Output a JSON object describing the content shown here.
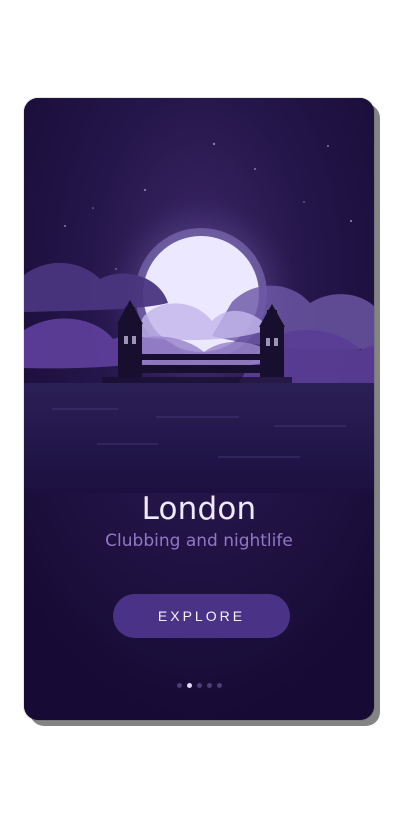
{
  "screen": {
    "title": "London",
    "subtitle": "Clubbing and nightlife",
    "button_label": "EXPLORE",
    "pagination": {
      "count": 5,
      "active_index": 1
    }
  },
  "colors": {
    "card_background": "#1b0f3c",
    "title_text": "#eeeaf9",
    "subtitle_text": "#8f78c5",
    "button_background": "#4a3386",
    "button_text": "#f4f0ff",
    "active_dot": "#e2d9ff",
    "inactive_dot": "#4b3d75"
  },
  "icons": {
    "hero_illustration": "night-london-bridge-moon-illustration"
  }
}
